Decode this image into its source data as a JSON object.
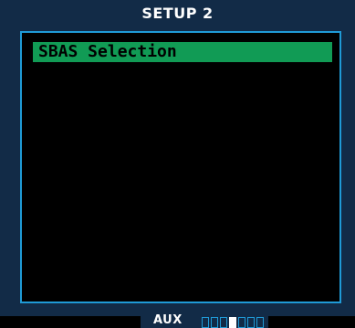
{
  "screen": {
    "title": "SETUP 2",
    "menu": {
      "items": [
        {
          "label": "SBAS Selection",
          "selected": true
        }
      ]
    },
    "footer": {
      "page_group": "AUX",
      "page_count": 7,
      "active_page": 4
    }
  },
  "colors": {
    "background": "#122b47",
    "panel": "#000000",
    "border": "#1f9ad6",
    "selection": "#119b55",
    "title_text": "#ffffff"
  }
}
